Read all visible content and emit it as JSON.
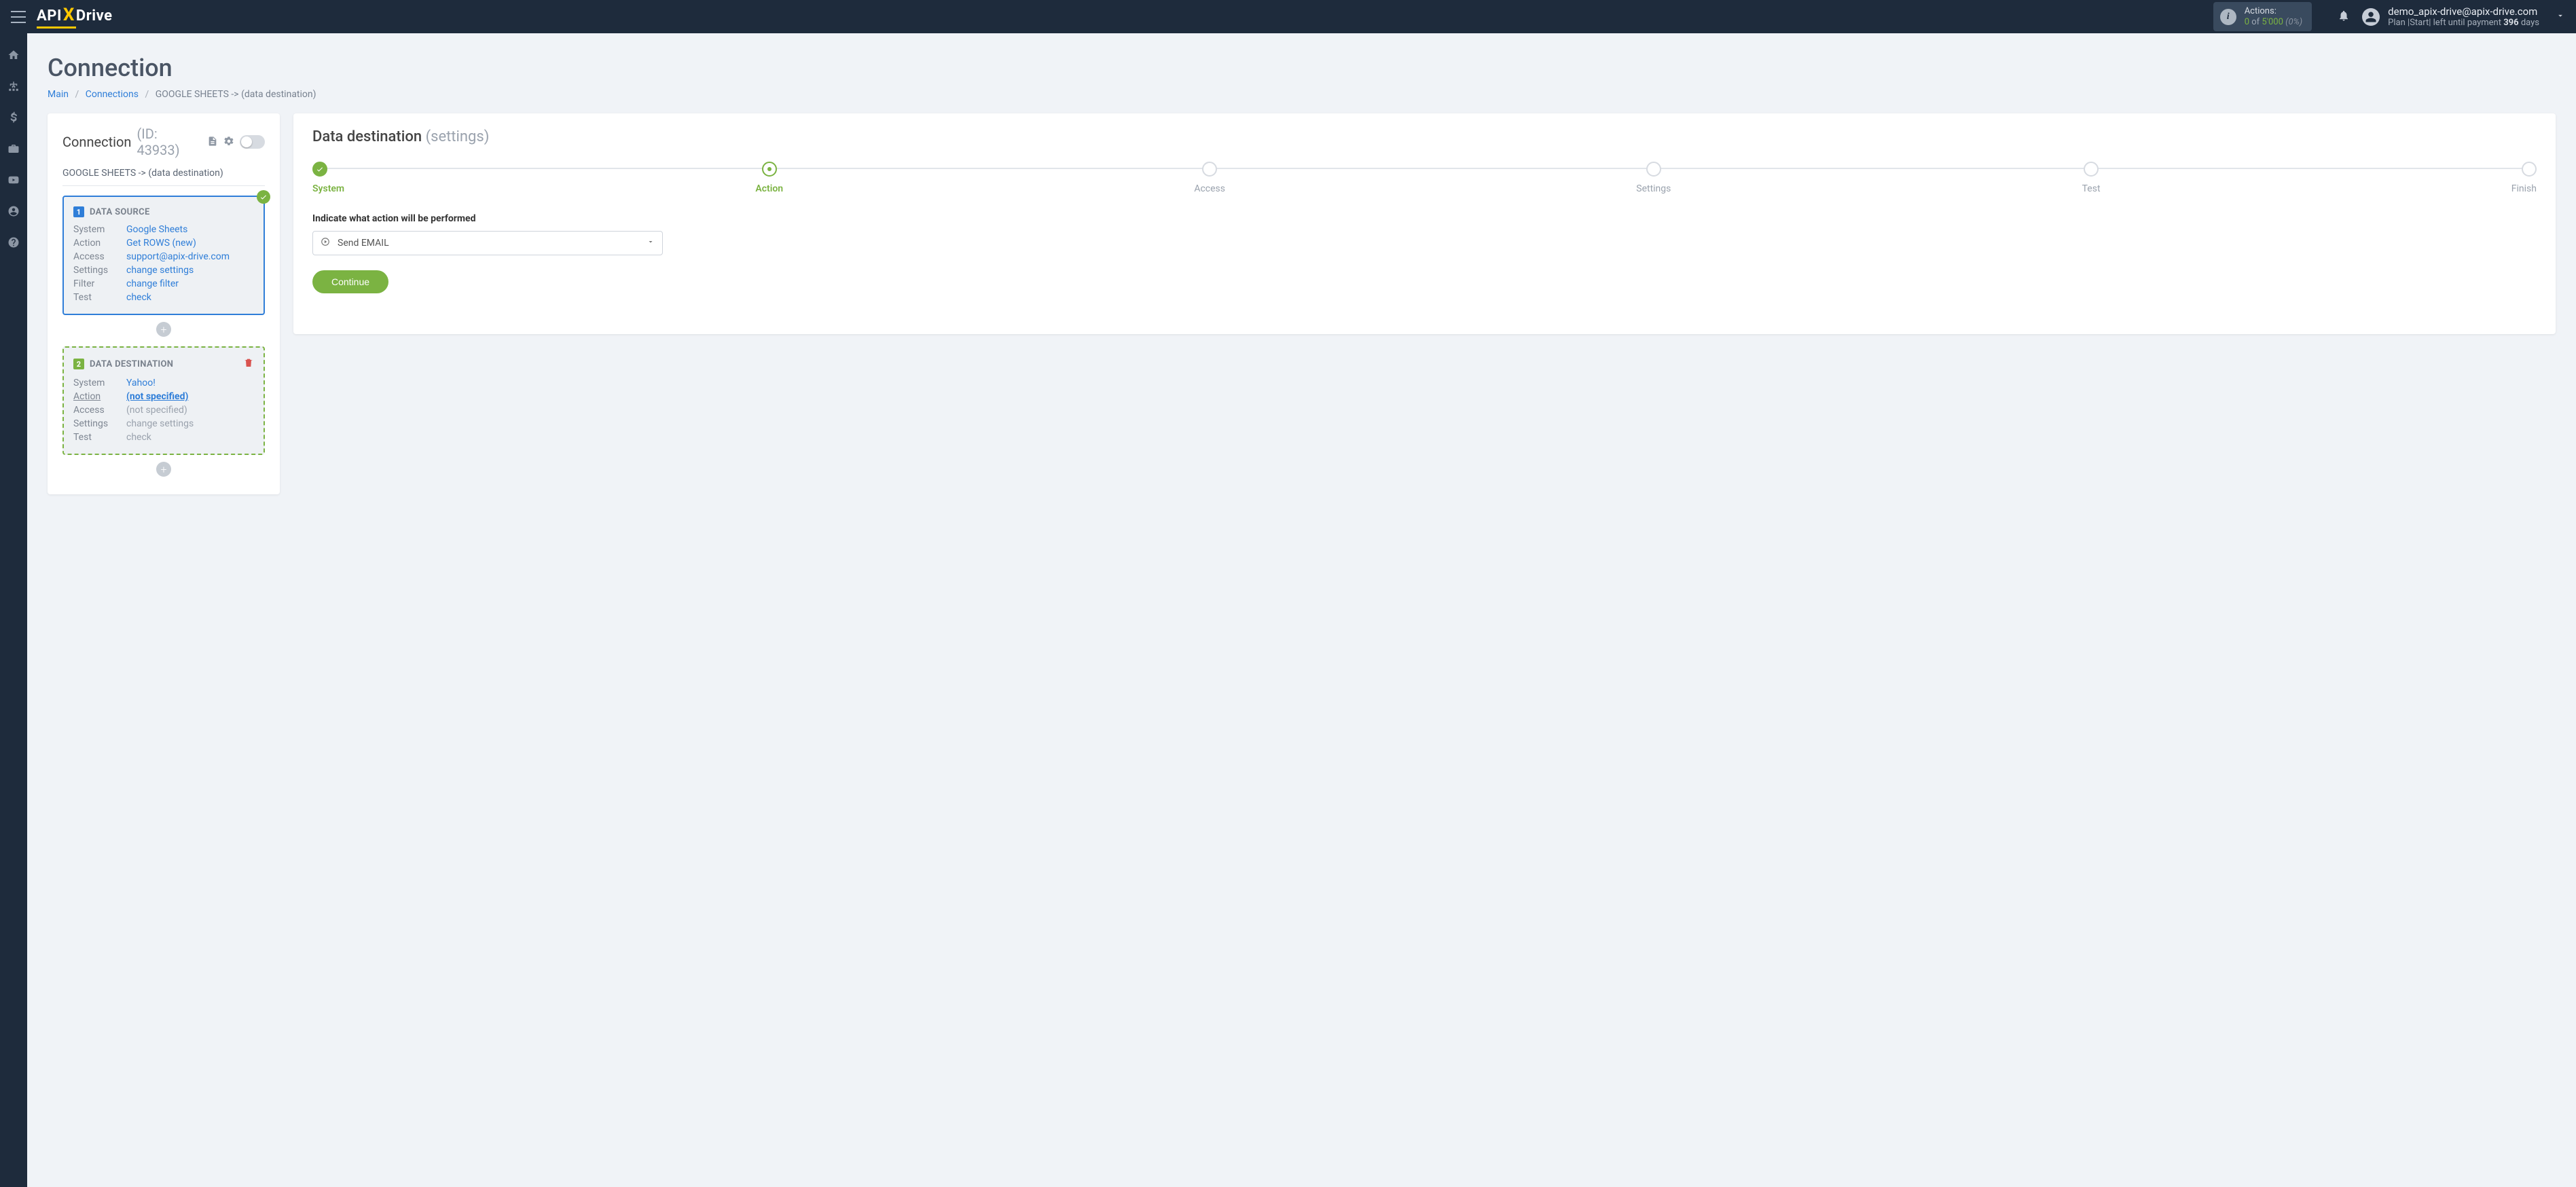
{
  "header": {
    "actions_label": "Actions:",
    "actions_used": "0",
    "actions_of": "of",
    "actions_total": "5'000",
    "actions_pct": "(0%)",
    "user_email": "demo_apix-drive@apix-drive.com",
    "plan_prefix": "Plan |",
    "plan_name": "Start",
    "plan_suffix": "| left until payment",
    "plan_days": "396",
    "plan_days_label": "days"
  },
  "page": {
    "title": "Connection",
    "breadcrumb_main": "Main",
    "breadcrumb_connections": "Connections",
    "breadcrumb_current": "GOOGLE SHEETS -> (data destination)"
  },
  "left": {
    "title": "Connection",
    "id_label": "(ID: 43933)",
    "path": "GOOGLE SHEETS -> (data destination)",
    "source_title": "DATA SOURCE",
    "source_num": "1",
    "dest_title": "DATA DESTINATION",
    "dest_num": "2",
    "row_system": "System",
    "row_action": "Action",
    "row_access": "Access",
    "row_settings": "Settings",
    "row_filter": "Filter",
    "row_test": "Test",
    "src_system": "Google Sheets",
    "src_action": "Get ROWS (new)",
    "src_access": "support@apix-drive.com",
    "src_settings": "change settings",
    "src_filter": "change filter",
    "src_test": "check",
    "dst_system": "Yahoo!",
    "dst_action": "(not specified)",
    "dst_access": "(not specified)",
    "dst_settings": "change settings",
    "dst_test": "check"
  },
  "right": {
    "title": "Data destination",
    "subtitle": "(settings)",
    "step_system": "System",
    "step_action": "Action",
    "step_access": "Access",
    "step_settings": "Settings",
    "step_test": "Test",
    "step_finish": "Finish",
    "form_label": "Indicate what action will be performed",
    "select_value": "Send EMAIL",
    "continue": "Continue"
  }
}
